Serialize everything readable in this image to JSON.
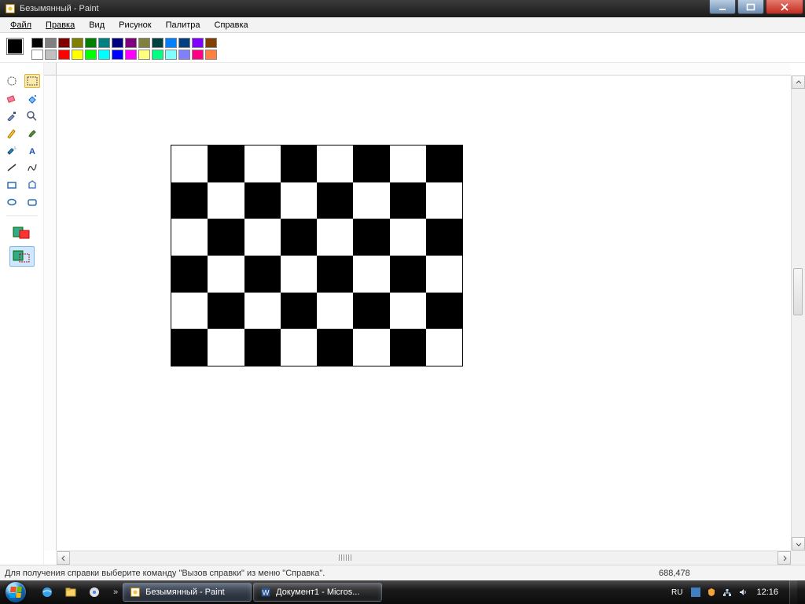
{
  "window": {
    "title": "Безымянный - Paint"
  },
  "menu": {
    "items": [
      "Файл",
      "Правка",
      "Вид",
      "Рисунок",
      "Палитра",
      "Справка"
    ]
  },
  "palette": {
    "current": "#000000",
    "row1": [
      "#000000",
      "#808080",
      "#800000",
      "#808000",
      "#008000",
      "#008080",
      "#000080",
      "#800080",
      "#808040",
      "#004040",
      "#0080ff",
      "#004080",
      "#8000ff",
      "#804000"
    ],
    "row2": [
      "#ffffff",
      "#c0c0c0",
      "#ff0000",
      "#ffff00",
      "#00ff00",
      "#00ffff",
      "#0000ff",
      "#ff00ff",
      "#ffff80",
      "#00ff80",
      "#80ffff",
      "#8080ff",
      "#ff0080",
      "#ff8040"
    ]
  },
  "tools": {
    "names": [
      [
        "freeform-select-icon",
        "rect-select-icon"
      ],
      [
        "eraser-icon",
        "fill-icon"
      ],
      [
        "eyedropper-icon",
        "zoom-icon"
      ],
      [
        "pencil-icon",
        "brush-icon"
      ],
      [
        "airbrush-icon",
        "text-icon"
      ],
      [
        "line-icon",
        "curve-icon"
      ],
      [
        "rect-icon",
        "polygon-icon"
      ],
      [
        "ellipse-icon",
        "rounded-rect-icon"
      ]
    ]
  },
  "status": {
    "help": "Для получения справки выберите команду \"Вызов справки\" из меню \"Справка\".",
    "coords": "688,478"
  },
  "taskbar": {
    "items": [
      {
        "icon": "paint-icon",
        "label": "Безымянный - Paint"
      },
      {
        "icon": "word-icon",
        "label": "Документ1 - Micros..."
      }
    ],
    "lang": "RU",
    "clock": "12:16"
  }
}
